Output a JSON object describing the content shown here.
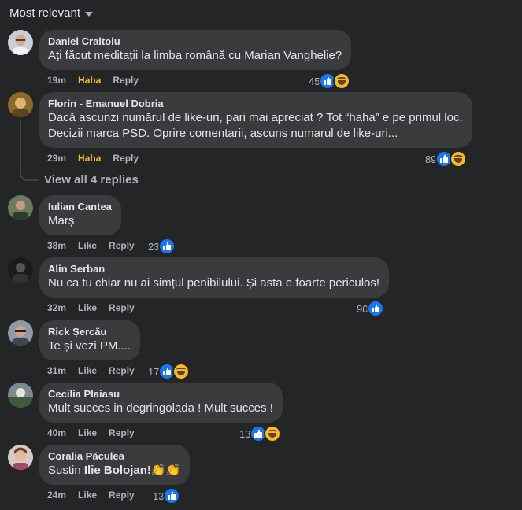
{
  "sort": {
    "label": "Most relevant",
    "icon": "caret-down-icon"
  },
  "colors": {
    "background": "#242526",
    "bubble": "#3a3b3c",
    "haha": "#f7b928",
    "like_blue": "#1877f2"
  },
  "comments": [
    {
      "author": "Daniel Craitoiu",
      "lines": [
        "Ați făcut meditații la limba română cu Marian Vanghelie?"
      ],
      "time": "19m",
      "reaction": "Haha",
      "reply": "Reply",
      "count": "45",
      "icons": [
        "like-icon",
        "haha-icon"
      ]
    },
    {
      "author": "Florin - Emanuel Dobria",
      "lines": [
        "Dacă ascunzi numărul de like-uri, pari mai apreciat ? Tot “haha” e pe primul loc.",
        "Decizii marca PSD. Oprire comentarii, ascuns numarul de like-uri..."
      ],
      "time": "29m",
      "reaction": "Haha",
      "reply": "Reply",
      "count": "89",
      "icons": [
        "like-icon",
        "haha-icon"
      ]
    },
    {
      "author": "Iulian Cantea",
      "lines": [
        "Marș"
      ],
      "time": "38m",
      "reaction": "Like",
      "reply": "Reply",
      "count": "23",
      "icons": [
        "like-icon"
      ]
    },
    {
      "author": "Alin Serban",
      "lines": [
        "Nu ca tu chiar nu ai simțul penibilului. Și asta e foarte periculos!"
      ],
      "time": "32m",
      "reaction": "Like",
      "reply": "Reply",
      "count": "90",
      "icons": [
        "like-icon"
      ]
    },
    {
      "author": "Rick Șercău",
      "lines": [
        "Te și vezi PM...."
      ],
      "time": "31m",
      "reaction": "Like",
      "reply": "Reply",
      "count": "17",
      "icons": [
        "like-icon",
        "haha-icon"
      ]
    },
    {
      "author": "Cecilia Plaiasu",
      "lines": [
        "Mult succes in degringolada ! Mult succes !"
      ],
      "time": "40m",
      "reaction": "Like",
      "reply": "Reply",
      "count": "13",
      "icons": [
        "like-icon",
        "haha-icon"
      ]
    },
    {
      "author": "Coralia Păculea",
      "text_pre": "Sustin ",
      "text_bold": "Ilie Bolojan!",
      "emoji": "👏👏",
      "time": "24m",
      "reaction": "Like",
      "reply": "Reply",
      "count": "13",
      "icons": [
        "like-icon"
      ]
    }
  ],
  "view_all": "View all 4 replies"
}
